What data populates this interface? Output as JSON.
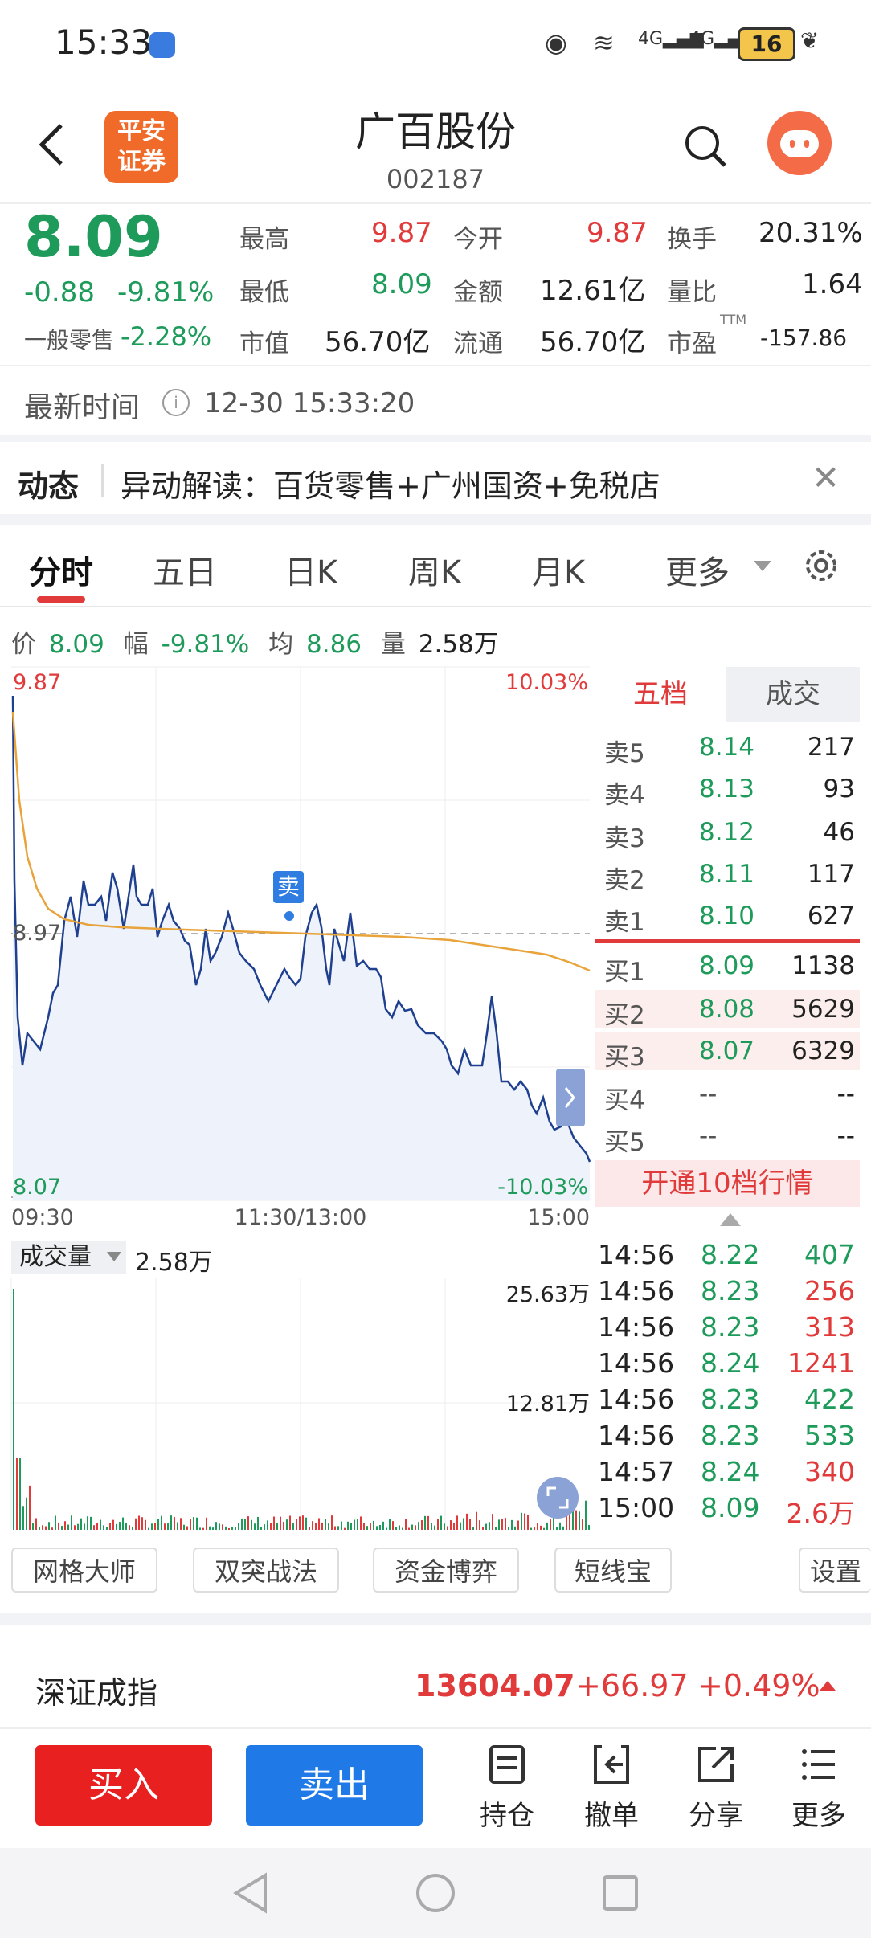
{
  "status_bar": {
    "time": "15:33",
    "network_1": "4G",
    "network_2": "4G",
    "battery": "16"
  },
  "header": {
    "broker_logo": "平安证券",
    "stock_name": "广百股份",
    "stock_code": "002187"
  },
  "quote": {
    "price": "8.09",
    "change": "-0.88",
    "change_pct": "-9.81%",
    "sector_label": "一般零售",
    "sector_pct": "-2.28%",
    "high_label": "最高",
    "high": "9.87",
    "low_label": "最低",
    "low": "8.09",
    "mktcap_label": "市值",
    "mktcap": "56.70亿",
    "open_label": "今开",
    "open": "9.87",
    "amount_label": "金额",
    "amount": "12.61亿",
    "float_label": "流通",
    "float": "56.70亿",
    "turnover_label": "换手",
    "turnover": "20.31%",
    "vol_ratio_label": "量比",
    "vol_ratio": "1.64",
    "pe_label": "市盈",
    "pe_sup": "TTM",
    "pe": "-157.86"
  },
  "latest_time": {
    "label": "最新时间",
    "value": "12-30 15:33:20"
  },
  "news": {
    "label": "动态",
    "text": "异动解读：百货零售+广州国资+免税店"
  },
  "tabs": [
    "分时",
    "五日",
    "日K",
    "周K",
    "月K",
    "更多"
  ],
  "info_row": {
    "price_label": "价",
    "price": "8.09",
    "range_label": "幅",
    "range": "-9.81%",
    "avg_label": "均",
    "avg": "8.86",
    "vol_label": "量",
    "vol": "2.58万"
  },
  "chart_axes": {
    "y_top": "9.87",
    "y_top_pct": "10.03%",
    "y_mid": "8.97",
    "y_bottom": "8.07",
    "y_bottom_pct": "-10.03%",
    "x_start": "09:30",
    "x_mid": "11:30/13:00",
    "x_end": "15:00",
    "sell_marker": "卖"
  },
  "order_book": {
    "tab_five": "五档",
    "tab_deal": "成交",
    "asks": [
      {
        "label": "卖5",
        "price": "8.14",
        "vol": "217"
      },
      {
        "label": "卖4",
        "price": "8.13",
        "vol": "93"
      },
      {
        "label": "卖3",
        "price": "8.12",
        "vol": "46"
      },
      {
        "label": "卖2",
        "price": "8.11",
        "vol": "117"
      },
      {
        "label": "卖1",
        "price": "8.10",
        "vol": "627"
      }
    ],
    "bids": [
      {
        "label": "买1",
        "price": "8.09",
        "vol": "1138"
      },
      {
        "label": "买2",
        "price": "8.08",
        "vol": "5629"
      },
      {
        "label": "买3",
        "price": "8.07",
        "vol": "6329"
      },
      {
        "label": "买4",
        "price": "--",
        "vol": "--"
      },
      {
        "label": "买5",
        "price": "--",
        "vol": "--"
      }
    ],
    "open_10": "开通10档行情"
  },
  "volume_chart": {
    "selector": "成交量",
    "value": "2.58万",
    "top": "25.63万",
    "mid": "12.81万"
  },
  "ticks": [
    {
      "time": "14:56",
      "price": "8.22",
      "vol": "407",
      "dir": "buy"
    },
    {
      "time": "14:56",
      "price": "8.23",
      "vol": "256",
      "dir": "sell"
    },
    {
      "time": "14:56",
      "price": "8.23",
      "vol": "313",
      "dir": "sell"
    },
    {
      "time": "14:56",
      "price": "8.24",
      "vol": "1241",
      "dir": "sell"
    },
    {
      "time": "14:56",
      "price": "8.23",
      "vol": "422",
      "dir": "buy"
    },
    {
      "time": "14:56",
      "price": "8.23",
      "vol": "533",
      "dir": "buy"
    },
    {
      "time": "14:57",
      "price": "8.24",
      "vol": "340",
      "dir": "sell"
    },
    {
      "time": "15:00",
      "price": "8.09",
      "vol": "2.6万",
      "dir": "sell"
    }
  ],
  "strategies": [
    "网格大师",
    "双突战法",
    "资金博弈",
    "短线宝",
    "设置"
  ],
  "index": {
    "name": "深证成指",
    "value": "13604.07",
    "change": "+66.97",
    "pct": "+0.49%"
  },
  "bottom_bar": {
    "buy": "买入",
    "sell": "卖出",
    "items": [
      "持仓",
      "撤单",
      "分享",
      "更多"
    ]
  },
  "colors": {
    "up": "#e03a3a",
    "down": "#1e9b5a",
    "price_line": "#1f3f8f",
    "avg_line": "#e8a33a",
    "buy_button": "#e82020",
    "sell_button": "#1f7ae8"
  }
}
